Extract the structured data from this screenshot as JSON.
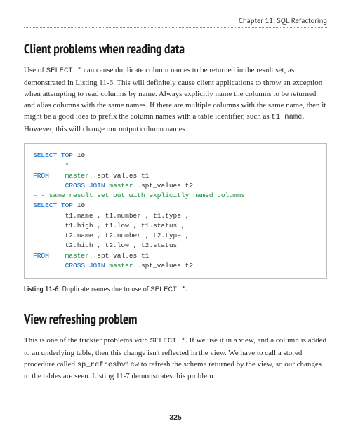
{
  "chapter_header": "Chapter 11: SQL Refactoring",
  "section1": {
    "heading": "Client problems when reading data",
    "para_parts": [
      "Use of ",
      "SELECT *",
      " can cause duplicate column names to be returned in the result set, as demonstrated in Listing 11-6. This will definitely cause client applications to throw an exception when attempting to read columns by name. Always explicitly name the columns to be returned and alias columns with the same names. If there are multiple columns with the same name, then it might be a good idea to prefix the column names with a table identifier, such as ",
      "t1_name",
      ". However, this will change our output column names."
    ],
    "code": {
      "l1": {
        "kw": "SELECT TOP",
        "rest": " 10"
      },
      "l2": "        *",
      "l3": {
        "kw": "FROM",
        "sp": "    ",
        "ident1": "master",
        "op": "..",
        "ident2": "spt_values t1"
      },
      "l4": {
        "sp": "        ",
        "kw": "CROSS JOIN",
        "sp2": " ",
        "ident1": "master",
        "op": "..",
        "ident2": "spt_values t2"
      },
      "l5": "– – same result set but with explicitly named columns",
      "l6": {
        "kw": "SELECT TOP",
        "rest": " 10"
      },
      "l7": "        t1.name , t1.number , t1.type ,",
      "l8": "        t1.high , t1.low , t1.status ,",
      "l9": "        t2.name , t2.number , t2.type ,",
      "l10": "        t2.high , t2.low , t2.status",
      "l11": {
        "kw": "FROM",
        "sp": "    ",
        "ident1": "master",
        "op": "..",
        "ident2": "spt_values t1"
      },
      "l12": {
        "sp": "        ",
        "kw": "CROSS JOIN",
        "sp2": " ",
        "ident1": "master",
        "op": "..",
        "ident2": "spt_values t2"
      }
    },
    "caption_label": "Listing 11-6:",
    "caption_text": "  Duplicate names due to use of ",
    "caption_code": "SELECT *",
    "caption_end": "."
  },
  "section2": {
    "heading": "View refreshing problem",
    "para_parts": [
      "This is one of the trickier problems with ",
      "SELECT *",
      ". If we use it in a view, and a column is added to an underlying table, then this change isn't reflected in the view. We have to call a stored procedure called ",
      "sp_refreshview",
      " to refresh the schema returned by the view, so our changes to the tables are seen. Listing 11-7 demonstrates this problem."
    ]
  },
  "page_number": "325"
}
